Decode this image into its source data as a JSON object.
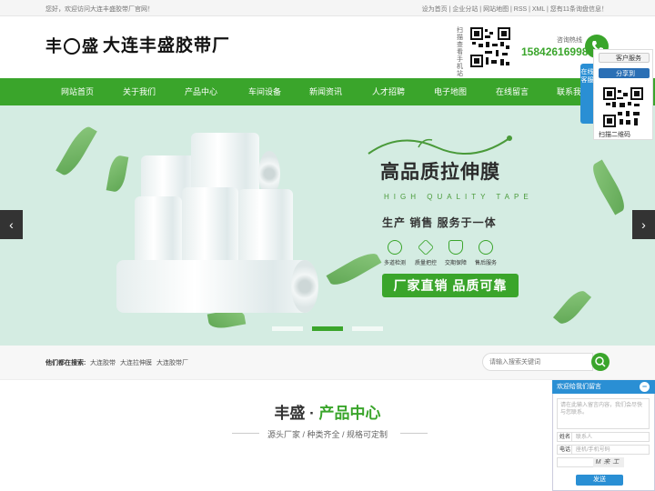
{
  "topbar": {
    "welcome": "您好，欢迎访问大连丰盛胶带厂官网！",
    "links": "设为首页 | 企业分站 | 网站地图 | RSS | XML | 您有11条询盘信息！"
  },
  "header": {
    "logo_chars": [
      "丰",
      "盛"
    ],
    "title": "大连丰盛胶带厂",
    "scan_text": "扫描查看手机站",
    "hotline_label": "咨询热线",
    "hotline": "15842616998"
  },
  "nav": {
    "items": [
      "网站首页",
      "关于我们",
      "产品中心",
      "车间设备",
      "新闻资讯",
      "人才招聘",
      "电子地图",
      "在线留言",
      "联系我"
    ]
  },
  "banner": {
    "title": "高品质拉伸膜",
    "subtitle_en": "HIGH QUALITY TAPE",
    "tagline": "生产 销售 服务于一体",
    "features": [
      "多道检测",
      "质量把控",
      "交期保障",
      "售后服务"
    ],
    "slogan": "厂家直销 品质可靠",
    "prev": "‹",
    "next": "›"
  },
  "search": {
    "hot_label": "他们都在搜索:",
    "keywords": [
      "大连胶带",
      "大连拉伸膜",
      "大连胶带厂"
    ],
    "placeholder": "请输入搜索关键词"
  },
  "section": {
    "title_a": "丰盛 · ",
    "title_b": "产品中心",
    "subtitle": "源头厂家 / 种类齐全 / 规格可定制"
  },
  "service": {
    "tab": "在线客服",
    "customer_service": "客户服务",
    "share": "分享到",
    "qr_label": "扫描二维码"
  },
  "message": {
    "header": "欢迎给我们留言",
    "minimize": "−",
    "content_placeholder": "请在此输入留言内容，我们会尽快与您联系。",
    "name_label": "姓名",
    "name_placeholder": "联系人",
    "phone_label": "电话",
    "phone_placeholder": "座机/手机号码",
    "captcha_text": "M来工",
    "send": "发送"
  },
  "colors": {
    "brand_green": "#3aa52b",
    "service_blue": "#2a8fd4"
  }
}
